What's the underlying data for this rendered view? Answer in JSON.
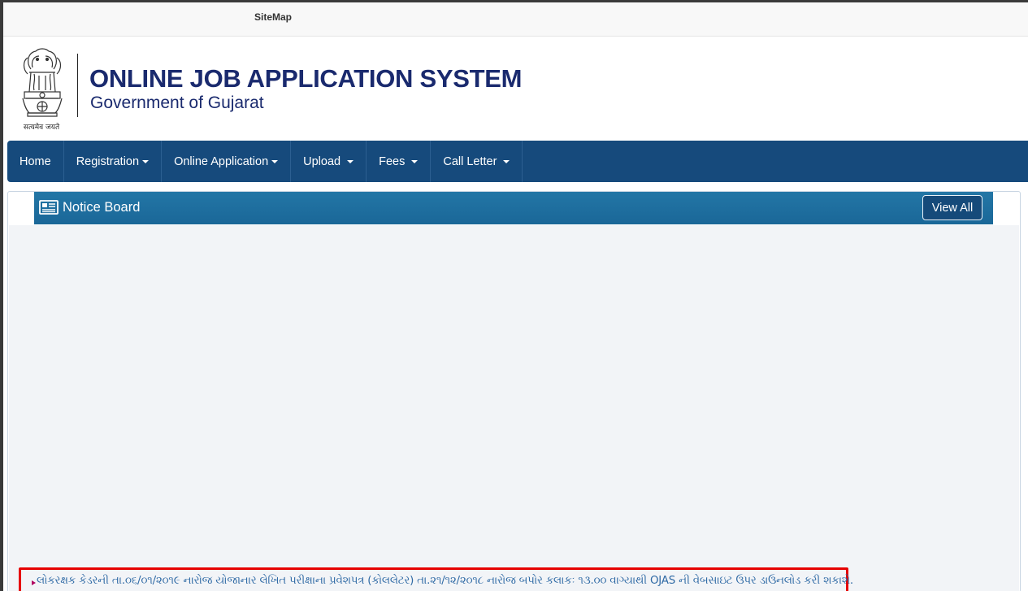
{
  "topbar": {
    "sitemap_label": "SiteMap"
  },
  "header": {
    "title": "ONLINE JOB APPLICATION SYSTEM",
    "subtitle": "Government of Gujarat",
    "emblem_motto": "सत्यमेव जयते"
  },
  "nav": {
    "items": [
      {
        "label": "Home",
        "has_dropdown": false
      },
      {
        "label": "Registration",
        "has_dropdown": true
      },
      {
        "label": "Online Application",
        "has_dropdown": true
      },
      {
        "label": "Upload",
        "has_dropdown": true
      },
      {
        "label": "Fees",
        "has_dropdown": true
      },
      {
        "label": "Call Letter",
        "has_dropdown": true
      }
    ]
  },
  "notice_board": {
    "title": "Notice Board",
    "icon": "newspaper-icon",
    "view_all_label": "View All",
    "notices": [
      {
        "text": "લોકરક્ષક કેડરની તા.૦૬/૦૧/૨૦૧૯ નારોજ યોજાનાર લેખિત પરીક્ષાના પ્રવેશપત્ર (કોલલેટર) તા.૨૧/૧૨/૨૦૧૮ નારોજ બપોર કલાકઃ ૧૩.૦૦ વાગ્યાથી OJAS ની વેબસાઇટ ઉપર ડાઉનલોડ કરી શકાશે.",
        "highlighted": true
      }
    ]
  },
  "colors": {
    "navbar": "#164a7c",
    "panel_header": "#1a6798",
    "title_text": "#1a2a6e",
    "notice_text": "#2f6aa5",
    "highlight_border": "#e60000"
  }
}
